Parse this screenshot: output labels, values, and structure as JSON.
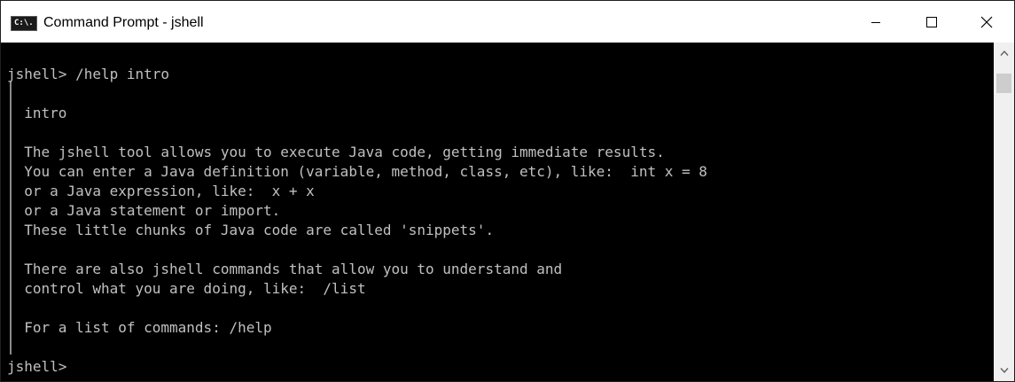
{
  "window": {
    "title": "Command Prompt - jshell",
    "icon": "cmd-app-icon",
    "icon_label": "C:\\."
  },
  "caption_buttons": {
    "minimize_icon": "minimize-icon",
    "maximize_icon": "maximize-icon",
    "close_icon": "close-icon"
  },
  "terminal": {
    "lines": [
      "jshell> /help intro",
      "",
      "  intro",
      "",
      "  The jshell tool allows you to execute Java code, getting immediate results.",
      "  You can enter a Java definition (variable, method, class, etc), like:  int x = 8",
      "  or a Java expression, like:  x + x",
      "  or a Java statement or import.",
      "  These little chunks of Java code are called 'snippets'.",
      "",
      "  There are also jshell commands that allow you to understand and",
      "  control what you are doing, like:  /list",
      "",
      "  For a list of commands: /help",
      "",
      "jshell>"
    ]
  },
  "scrollbar": {
    "up_icon": "scroll-up-icon",
    "down_icon": "scroll-down-icon"
  }
}
